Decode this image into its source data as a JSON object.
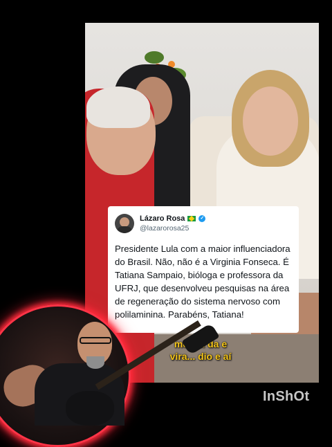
{
  "tweet": {
    "name": "Lázaro Rosa",
    "flag_icon": "brazil-flag-icon",
    "verified_icon": "verified-badge-icon",
    "handle": "@lazarorosa25",
    "text": "Presidente Lula com a maior influenciadora do Brasil. Não, não é a Virginia Fonseca. É Tatiana Sampaio, bióloga e professora da UFRJ, que desenvolveu pesquisas na área de regeneração do sistema nervoso com polilaminina. Parabéns, Tatiana!"
  },
  "video": {
    "caption_line1": "meio... da e",
    "caption_line2": "vira... dio e aí",
    "caption_color": "#f2c318"
  },
  "watermark": "InShOt",
  "overlay": {
    "ring_color": "#ff3447"
  }
}
